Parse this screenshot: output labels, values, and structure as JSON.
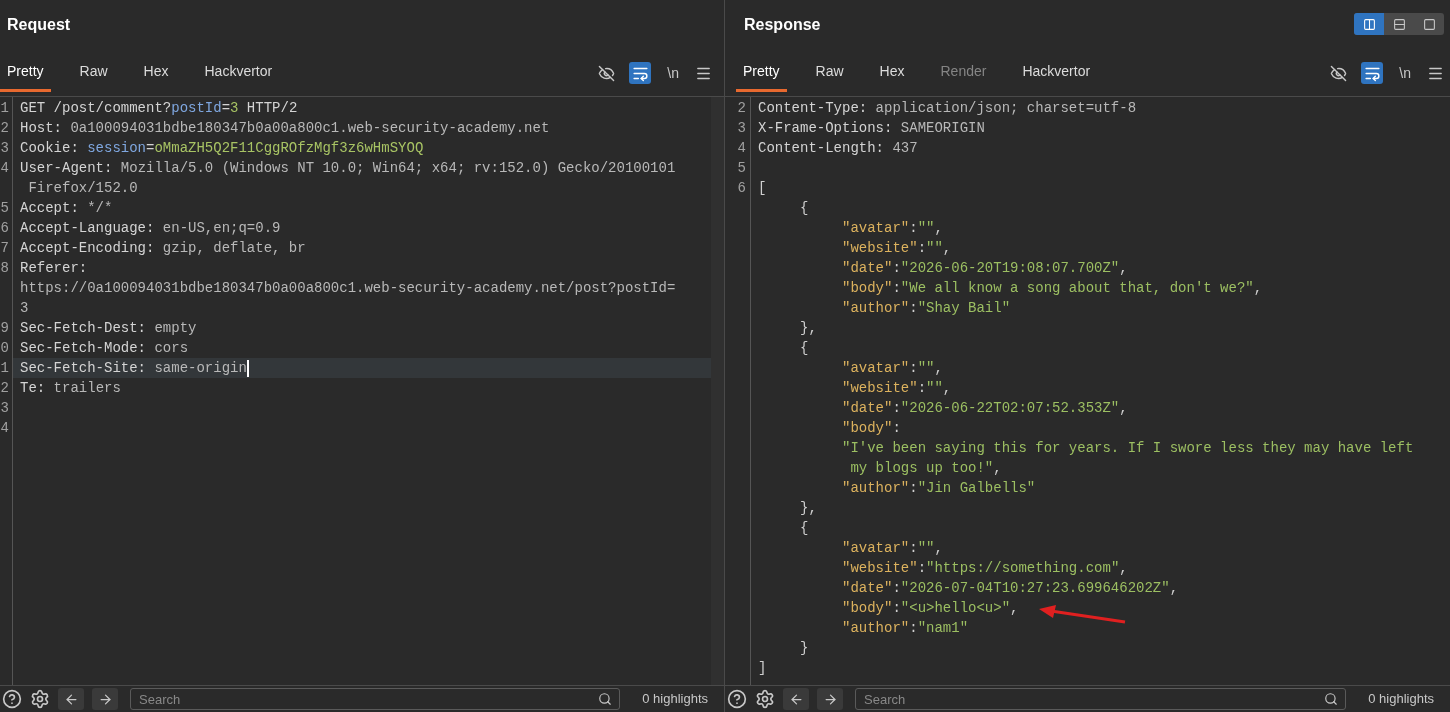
{
  "request": {
    "title": "Request",
    "tabs": [
      {
        "label": "Pretty",
        "selected": true,
        "disabled": false
      },
      {
        "label": "Raw",
        "selected": false,
        "disabled": false
      },
      {
        "label": "Hex",
        "selected": false,
        "disabled": false
      },
      {
        "label": "Hackvertor",
        "selected": false,
        "disabled": false
      }
    ],
    "toggles": [
      {
        "kind": "hide",
        "on": false
      },
      {
        "kind": "wrap",
        "on": true
      }
    ],
    "newline_toggle": "\\n",
    "lines": [
      {
        "number": "1",
        "tokens": [
          {
            "text": "GET /post/comment?",
            "kind": "plain"
          },
          {
            "text": "postId",
            "kind": "param"
          },
          {
            "text": "=",
            "kind": "plain"
          },
          {
            "text": "3",
            "kind": "param_value"
          },
          {
            "text": " HTTP/2",
            "kind": "plain"
          }
        ]
      },
      {
        "number": "2",
        "tokens": [
          {
            "text": "Host:",
            "kind": "name"
          },
          {
            "text": " 0a100094031bdbe180347b0a00a800c1.web-security-academy.net",
            "kind": "value"
          }
        ]
      },
      {
        "number": "3",
        "tokens": [
          {
            "text": "Cookie:",
            "kind": "name"
          },
          {
            "text": " session",
            "kind": "param"
          },
          {
            "text": "=",
            "kind": "plain"
          },
          {
            "text": "oMmaZH5Q2F11CggROfzMgf3z6wHmSYOQ",
            "kind": "param_value"
          }
        ]
      },
      {
        "number": "4",
        "tokens": [
          {
            "text": "User-Agent:",
            "kind": "name"
          },
          {
            "text": " Mozilla/5.0 (Windows NT 10.0; Win64; x64; rv:152.0) Gecko/20100101",
            "kind": "value"
          }
        ]
      },
      {
        "tokens": [
          {
            "text": " Firefox/152.0",
            "kind": "value"
          }
        ]
      },
      {
        "number": "5",
        "tokens": [
          {
            "text": "Accept:",
            "kind": "name"
          },
          {
            "text": " */*",
            "kind": "value"
          }
        ]
      },
      {
        "number": "6",
        "tokens": [
          {
            "text": "Accept-Language:",
            "kind": "name"
          },
          {
            "text": " en-US,en;q=0.9",
            "kind": "value"
          }
        ]
      },
      {
        "number": "7",
        "tokens": [
          {
            "text": "Accept-Encoding:",
            "kind": "name"
          },
          {
            "text": " gzip, deflate, br",
            "kind": "value"
          }
        ]
      },
      {
        "number": "8",
        "tokens": [
          {
            "text": "Referer:",
            "kind": "name"
          }
        ]
      },
      {
        "tokens": [
          {
            "text": "https://0a100094031bdbe180347b0a00a800c1.web-security-academy.net/post?postId=",
            "kind": "value"
          }
        ]
      },
      {
        "tokens": [
          {
            "text": "3",
            "kind": "value"
          }
        ]
      },
      {
        "number": "9",
        "tokens": [
          {
            "text": "Sec-Fetch-Dest:",
            "kind": "name"
          },
          {
            "text": " empty",
            "kind": "value"
          }
        ]
      },
      {
        "number": "0",
        "tokens": [
          {
            "text": "Sec-Fetch-Mode:",
            "kind": "name"
          },
          {
            "text": " cors",
            "kind": "value"
          }
        ]
      },
      {
        "number": "1",
        "current": true,
        "tokens": [
          {
            "text": "Sec-Fetch-Site:",
            "kind": "name"
          },
          {
            "text": " same-origin",
            "kind": "value"
          }
        ]
      },
      {
        "number": "2",
        "tokens": [
          {
            "text": "Te:",
            "kind": "name"
          },
          {
            "text": " trailers",
            "kind": "value"
          }
        ]
      },
      {
        "number": "3"
      },
      {
        "number": "4"
      }
    ],
    "search": {
      "placeholder": "Search"
    },
    "highlights": "0 highlights"
  },
  "response": {
    "title": "Response",
    "layout_modes": [
      {
        "kind": "columns",
        "selected": true
      },
      {
        "kind": "rows",
        "selected": false
      },
      {
        "kind": "single",
        "selected": false
      }
    ],
    "tabs": [
      {
        "label": "Pretty",
        "selected": true,
        "disabled": false
      },
      {
        "label": "Raw",
        "selected": false,
        "disabled": false
      },
      {
        "label": "Hex",
        "selected": false,
        "disabled": false
      },
      {
        "label": "Render",
        "selected": false,
        "disabled": true
      },
      {
        "label": "Hackvertor",
        "selected": false,
        "disabled": false
      }
    ],
    "toggles": [
      {
        "kind": "hide",
        "on": false
      },
      {
        "kind": "wrap",
        "on": true
      }
    ],
    "newline_toggle": "\\n",
    "lines": [
      {
        "number": "2",
        "tokens": [
          {
            "text": "Content-Type:",
            "kind": "name"
          },
          {
            "text": " application/json; charset=utf-8",
            "kind": "value"
          }
        ]
      },
      {
        "number": "3",
        "tokens": [
          {
            "text": "X-Frame-Options:",
            "kind": "name"
          },
          {
            "text": " SAMEORIGIN",
            "kind": "value"
          }
        ]
      },
      {
        "number": "4",
        "tokens": [
          {
            "text": "Content-Length:",
            "kind": "name"
          },
          {
            "text": " 437",
            "kind": "value"
          }
        ]
      },
      {
        "number": "5"
      },
      {
        "number": "6",
        "tokens": [
          {
            "text": "[",
            "kind": "punct"
          }
        ]
      },
      {
        "tokens": [
          {
            "text": "     {",
            "kind": "punct"
          }
        ]
      },
      {
        "tokens": [
          {
            "text": "          \"avatar\"",
            "kind": "key"
          },
          {
            "text": ":",
            "kind": "punct"
          },
          {
            "text": "\"\"",
            "kind": "string"
          },
          {
            "text": ",",
            "kind": "punct"
          }
        ]
      },
      {
        "tokens": [
          {
            "text": "          \"website\"",
            "kind": "key"
          },
          {
            "text": ":",
            "kind": "punct"
          },
          {
            "text": "\"\"",
            "kind": "string"
          },
          {
            "text": ",",
            "kind": "punct"
          }
        ]
      },
      {
        "tokens": [
          {
            "text": "          \"date\"",
            "kind": "key"
          },
          {
            "text": ":",
            "kind": "punct"
          },
          {
            "text": "\"2026-06-20T19:08:07.700Z\"",
            "kind": "string"
          },
          {
            "text": ",",
            "kind": "punct"
          }
        ]
      },
      {
        "tokens": [
          {
            "text": "          \"body\"",
            "kind": "key"
          },
          {
            "text": ":",
            "kind": "punct"
          },
          {
            "text": "\"We all know a song about that, don't we?\"",
            "kind": "string"
          },
          {
            "text": ",",
            "kind": "punct"
          }
        ]
      },
      {
        "tokens": [
          {
            "text": "          \"author\"",
            "kind": "key"
          },
          {
            "text": ":",
            "kind": "punct"
          },
          {
            "text": "\"Shay Bail\"",
            "kind": "string"
          }
        ]
      },
      {
        "tokens": [
          {
            "text": "     },",
            "kind": "punct"
          }
        ]
      },
      {
        "tokens": [
          {
            "text": "     {",
            "kind": "punct"
          }
        ]
      },
      {
        "tokens": [
          {
            "text": "          \"avatar\"",
            "kind": "key"
          },
          {
            "text": ":",
            "kind": "punct"
          },
          {
            "text": "\"\"",
            "kind": "string"
          },
          {
            "text": ",",
            "kind": "punct"
          }
        ]
      },
      {
        "tokens": [
          {
            "text": "          \"website\"",
            "kind": "key"
          },
          {
            "text": ":",
            "kind": "punct"
          },
          {
            "text": "\"\"",
            "kind": "string"
          },
          {
            "text": ",",
            "kind": "punct"
          }
        ]
      },
      {
        "tokens": [
          {
            "text": "          \"date\"",
            "kind": "key"
          },
          {
            "text": ":",
            "kind": "punct"
          },
          {
            "text": "\"2026-06-22T02:07:52.353Z\"",
            "kind": "string"
          },
          {
            "text": ",",
            "kind": "punct"
          }
        ]
      },
      {
        "tokens": [
          {
            "text": "          \"body\"",
            "kind": "key"
          },
          {
            "text": ":",
            "kind": "punct"
          }
        ]
      },
      {
        "tokens": [
          {
            "text": "          \"I've been saying this for years. If I swore less they may have left",
            "kind": "string"
          }
        ]
      },
      {
        "tokens": [
          {
            "text": "           my blogs up too!\"",
            "kind": "string"
          },
          {
            "text": ",",
            "kind": "punct"
          }
        ]
      },
      {
        "tokens": [
          {
            "text": "          \"author\"",
            "kind": "key"
          },
          {
            "text": ":",
            "kind": "punct"
          },
          {
            "text": "\"Jin Galbells\"",
            "kind": "string"
          }
        ]
      },
      {
        "tokens": [
          {
            "text": "     },",
            "kind": "punct"
          }
        ]
      },
      {
        "tokens": [
          {
            "text": "     {",
            "kind": "punct"
          }
        ]
      },
      {
        "tokens": [
          {
            "text": "          \"avatar\"",
            "kind": "key"
          },
          {
            "text": ":",
            "kind": "punct"
          },
          {
            "text": "\"\"",
            "kind": "string"
          },
          {
            "text": ",",
            "kind": "punct"
          }
        ]
      },
      {
        "tokens": [
          {
            "text": "          \"website\"",
            "kind": "key"
          },
          {
            "text": ":",
            "kind": "punct"
          },
          {
            "text": "\"https://something.com\"",
            "kind": "string"
          },
          {
            "text": ",",
            "kind": "punct"
          }
        ]
      },
      {
        "tokens": [
          {
            "text": "          \"date\"",
            "kind": "key"
          },
          {
            "text": ":",
            "kind": "punct"
          },
          {
            "text": "\"2026-07-04T10:27:23.699646202Z\"",
            "kind": "string"
          },
          {
            "text": ",",
            "kind": "punct"
          }
        ]
      },
      {
        "tokens": [
          {
            "text": "          \"body\"",
            "kind": "key"
          },
          {
            "text": ":",
            "kind": "punct"
          },
          {
            "text": "\"<u>hello<u>\"",
            "kind": "string"
          },
          {
            "text": ",",
            "kind": "punct"
          }
        ]
      },
      {
        "tokens": [
          {
            "text": "          \"author\"",
            "kind": "key"
          },
          {
            "text": ":",
            "kind": "punct"
          },
          {
            "text": "\"nam1\"",
            "kind": "string"
          }
        ]
      },
      {
        "tokens": [
          {
            "text": "     }",
            "kind": "punct"
          }
        ]
      },
      {
        "tokens": [
          {
            "text": "]",
            "kind": "punct"
          }
        ]
      }
    ],
    "search": {
      "placeholder": "Search"
    },
    "highlights": "0 highlights"
  }
}
